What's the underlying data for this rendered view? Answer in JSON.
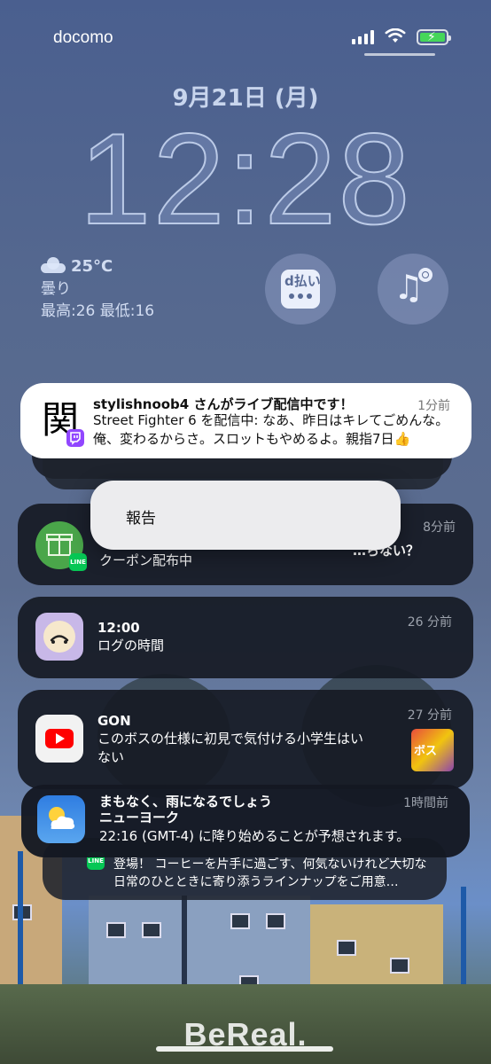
{
  "status_bar": {
    "carrier": "docomo"
  },
  "lock_screen": {
    "date": "9月21日 (月)",
    "time": "12:28"
  },
  "weather": {
    "temperature": "25°C",
    "condition": "曇り",
    "high_low": "最高:26 最低:16",
    "icon": "cloud-icon"
  },
  "widgets": {
    "dpay_label": "d払い",
    "music_icon": "music-note-icon"
  },
  "notifications": {
    "twitch": {
      "app_label": "関",
      "title": "stylishnoob4 さんがライブ配信中です！",
      "body": "Street Fighter 6 を配信中: なあ、昨日はキレてごめんな。俺、変わるからさ。スロットもやめるよ。親指7日👍",
      "time": "1分前"
    },
    "line_coupon": {
      "title_partial": "…らない？",
      "body": "クーポン配布中",
      "time": "8分前"
    },
    "log": {
      "title": "12:00",
      "body": "ログの時間",
      "time": "26 分前"
    },
    "youtube": {
      "title": "GON",
      "body": "このボスの仕様に初見で気付ける小学生はいない",
      "time": "27 分前",
      "thumb_text": "ボス"
    },
    "weather_alert": {
      "title": "まもなく、雨になるでしょう",
      "location": "ニューヨーク",
      "body": "22:16 (GMT-4) に降り始めることが予想されます。",
      "time": "1時間前"
    },
    "line_promo": {
      "body": "登場！ コーヒーを片手に過ごす、何気ないけれど大切な日常のひとときに寄り添うラインナップをご用意…"
    }
  },
  "context_menu": {
    "report_label": "報告"
  },
  "watermark": "BeReal."
}
